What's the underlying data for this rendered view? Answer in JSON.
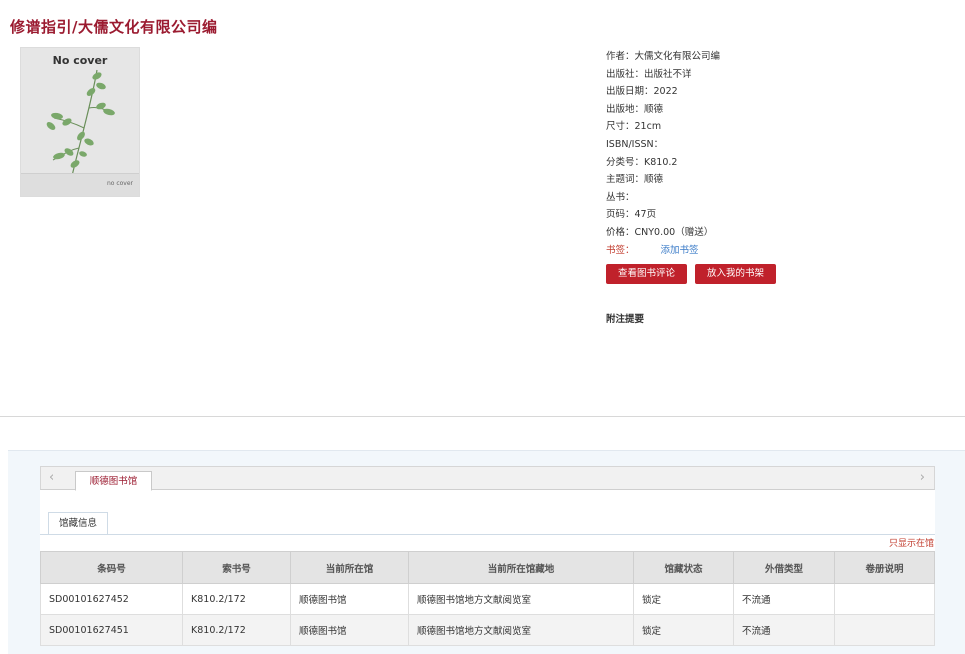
{
  "page_title": "修谱指引/大儒文化有限公司编",
  "cover": {
    "title": "No cover",
    "footer": "no cover"
  },
  "meta": [
    {
      "key": "作者：",
      "value": "大儒文化有限公司编"
    },
    {
      "key": "出版社：",
      "value": "出版社不详"
    },
    {
      "key": "出版日期：",
      "value": "2022"
    },
    {
      "key": "出版地：",
      "value": "顺德"
    },
    {
      "key": "尺寸：",
      "value": "21cm"
    },
    {
      "key": "ISBN/ISSN：",
      "value": ""
    },
    {
      "key": "分类号：",
      "value": "K810.2"
    },
    {
      "key": "主题词：",
      "value": "顺德"
    },
    {
      "key": "丛书：",
      "value": ""
    },
    {
      "key": "页码：",
      "value": "47页"
    },
    {
      "key": "价格：",
      "value": "CNY0.00（赠送）"
    }
  ],
  "bookmark": {
    "label": "书签：",
    "link": "添加书签"
  },
  "buttons": {
    "review": "查看图书评论",
    "shelf": "放入我的书架"
  },
  "notes_label": "附注提要",
  "library_tabs": {
    "prev_icon": "‹",
    "next_icon": "›",
    "active": "顺德图书馆"
  },
  "holdings_tab": "馆藏信息",
  "only_show_link": "只显示在馆",
  "holdings": {
    "columns": [
      "条码号",
      "索书号",
      "当前所在馆",
      "当前所在馆藏地",
      "馆藏状态",
      "外借类型",
      "卷册说明"
    ],
    "rows": [
      [
        "SD00101627452",
        "K810.2/172",
        "顺德图书馆",
        "顺德图书馆地方文献阅览室",
        "锁定",
        "不流通",
        ""
      ],
      [
        "SD00101627451",
        "K810.2/172",
        "顺德图书馆",
        "顺德图书馆地方文献阅览室",
        "锁定",
        "不流通",
        ""
      ]
    ]
  },
  "colors": {
    "accent": "#9b1b30",
    "button": "#c0212b",
    "link": "#3a7bc8"
  }
}
